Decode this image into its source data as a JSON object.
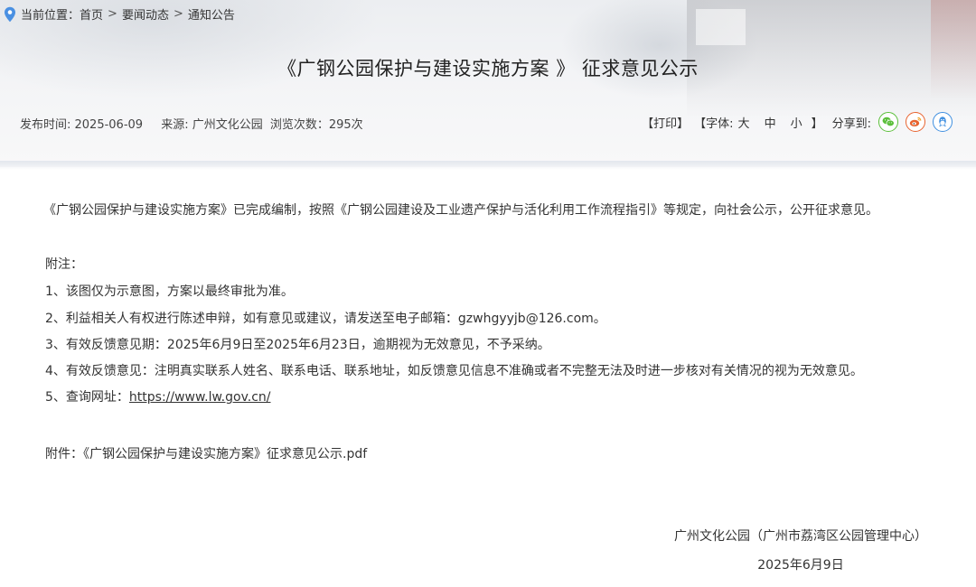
{
  "breadcrumb": {
    "label": "当前位置：",
    "items": [
      "首页",
      "要闻动态",
      "通知公告"
    ],
    "separator": ">"
  },
  "article": {
    "title": "《广钢公园保护与建设实施方案 》 征求意见公示",
    "publish_time": "发布时间: 2025-06-09",
    "source": "来源: 广州文化公园",
    "views": "浏览次数：295次"
  },
  "toolbar": {
    "print": "【打印】",
    "font_label": "【字体:",
    "font_large": "大",
    "font_medium": "中",
    "font_small": "小",
    "font_close": "】",
    "share_label": "分享到:",
    "share_icons": [
      "wechat-icon",
      "weibo-icon",
      "qq-icon"
    ],
    "colors": {
      "wechat": "#5bbf3a",
      "weibo": "#e8632f",
      "qq": "#3f8fe0"
    }
  },
  "body": {
    "intro": "《广钢公园保护与建设实施方案》已完成编制，按照《广钢公园建设及工业遗产保护与活化利用工作流程指引》等规定，向社会公示，公开征求意见。",
    "note_heading": "附注：",
    "notes": [
      "1、该图仅为示意图，方案以最终审批为准。",
      "2、利益相关人有权进行陈述申辩，如有意见或建议，请发送至电子邮箱：gzwhgyyjb@126.com。",
      "3、有效反馈意见期：2025年6月9日至2025年6月23日，逾期视为无效意见，不予采纳。",
      "4、有效反馈意见：注明真实联系人姓名、联系电话、联系地址，如反馈意见信息不准确或者不完整无法及时进一步核对有关情况的视为无效意见。"
    ],
    "query_prefix": "5、查询网址：",
    "query_url": "https://www.lw.gov.cn/",
    "attachment": "附件：《广钢公园保护与建设实施方案》征求意见公示.pdf"
  },
  "signature": {
    "org": "广州文化公园（广州市荔湾区公园管理中心）",
    "date": "2025年6月9日"
  }
}
